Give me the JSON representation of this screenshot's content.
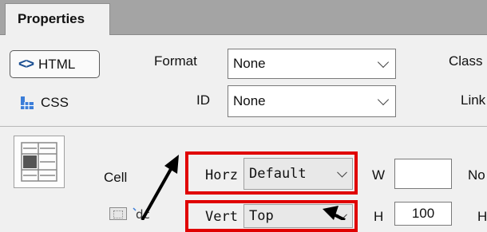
{
  "tab": {
    "label": "Properties"
  },
  "modes": {
    "html_label": "HTML",
    "css_label": "CSS"
  },
  "format": {
    "label": "Format",
    "value": "None"
  },
  "id": {
    "label": "ID",
    "value": "None"
  },
  "right_labels": {
    "class": "Class",
    "link": "Link"
  },
  "cell": {
    "label": "Cell"
  },
  "horz": {
    "label": "Horz",
    "value": "Default"
  },
  "vert": {
    "label": "Vert",
    "value": "Top"
  },
  "w": {
    "label": "W",
    "value": ""
  },
  "h": {
    "label": "H",
    "value": "100"
  },
  "right_edge": {
    "no": "No",
    "h": "H"
  },
  "colors": {
    "highlight": "#e00000",
    "tab_strip": "#a4a4a4",
    "html_icon": "#1b4f92"
  }
}
